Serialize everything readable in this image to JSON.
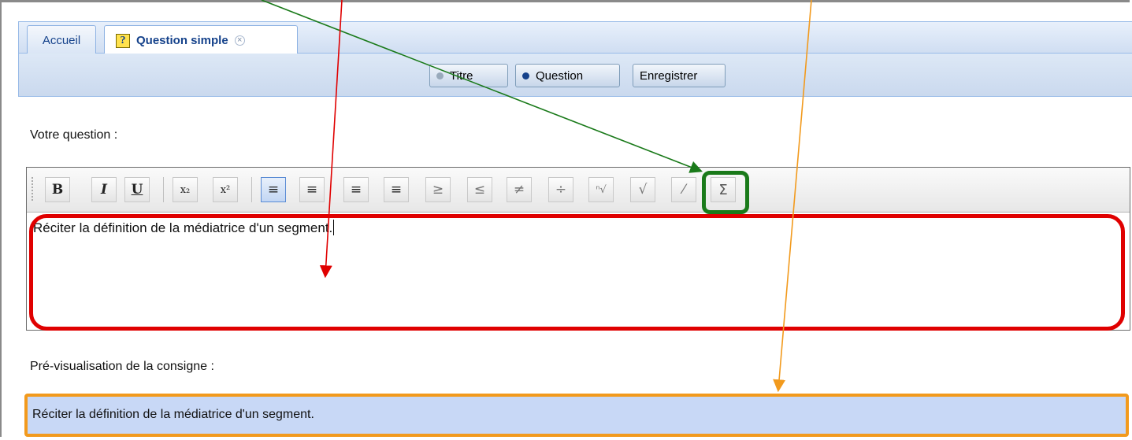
{
  "tabs": [
    {
      "label": "Accueil"
    },
    {
      "label": "Question simple",
      "icon": "question-icon",
      "close_icon": "close-icon"
    }
  ],
  "toolbar": {
    "titre_label": "Titre",
    "question_label": "Question",
    "save_label": "Enregistrer"
  },
  "form": {
    "question_label": "Votre question :",
    "question_text": "Réciter la définition de la médiatrice d'un segment.",
    "preview_label": "Pré-visualisation de la consigne :",
    "preview_text": "Réciter la définition de la médiatrice d'un segment."
  },
  "editor_toolbar": {
    "buttons": [
      {
        "name": "bold",
        "glyph": "B"
      },
      {
        "name": "italic",
        "glyph": "I"
      },
      {
        "name": "underline",
        "glyph": "U"
      },
      {
        "name": "subscript",
        "glyph": "x₂"
      },
      {
        "name": "superscript",
        "glyph": "x²"
      },
      {
        "name": "align-left",
        "glyph": "≡"
      },
      {
        "name": "align-center",
        "glyph": "≡"
      },
      {
        "name": "align-right",
        "glyph": "≡"
      },
      {
        "name": "justify",
        "glyph": "≡"
      },
      {
        "name": "greater-equal",
        "glyph": "≥"
      },
      {
        "name": "less-equal",
        "glyph": "≤"
      },
      {
        "name": "not-equal",
        "glyph": "≠"
      },
      {
        "name": "divide",
        "glyph": "÷"
      },
      {
        "name": "nth-root",
        "glyph": "ⁿ√"
      },
      {
        "name": "square-root",
        "glyph": "√"
      },
      {
        "name": "fraction",
        "glyph": "⁄"
      },
      {
        "name": "sum",
        "glyph": "Σ"
      }
    ]
  },
  "colors": {
    "highlight_red": "#e00000",
    "highlight_green": "#1a7a1a",
    "highlight_orange": "#f29a1d",
    "preview_bg": "#c8d8f6",
    "tab_text": "#15428b"
  }
}
